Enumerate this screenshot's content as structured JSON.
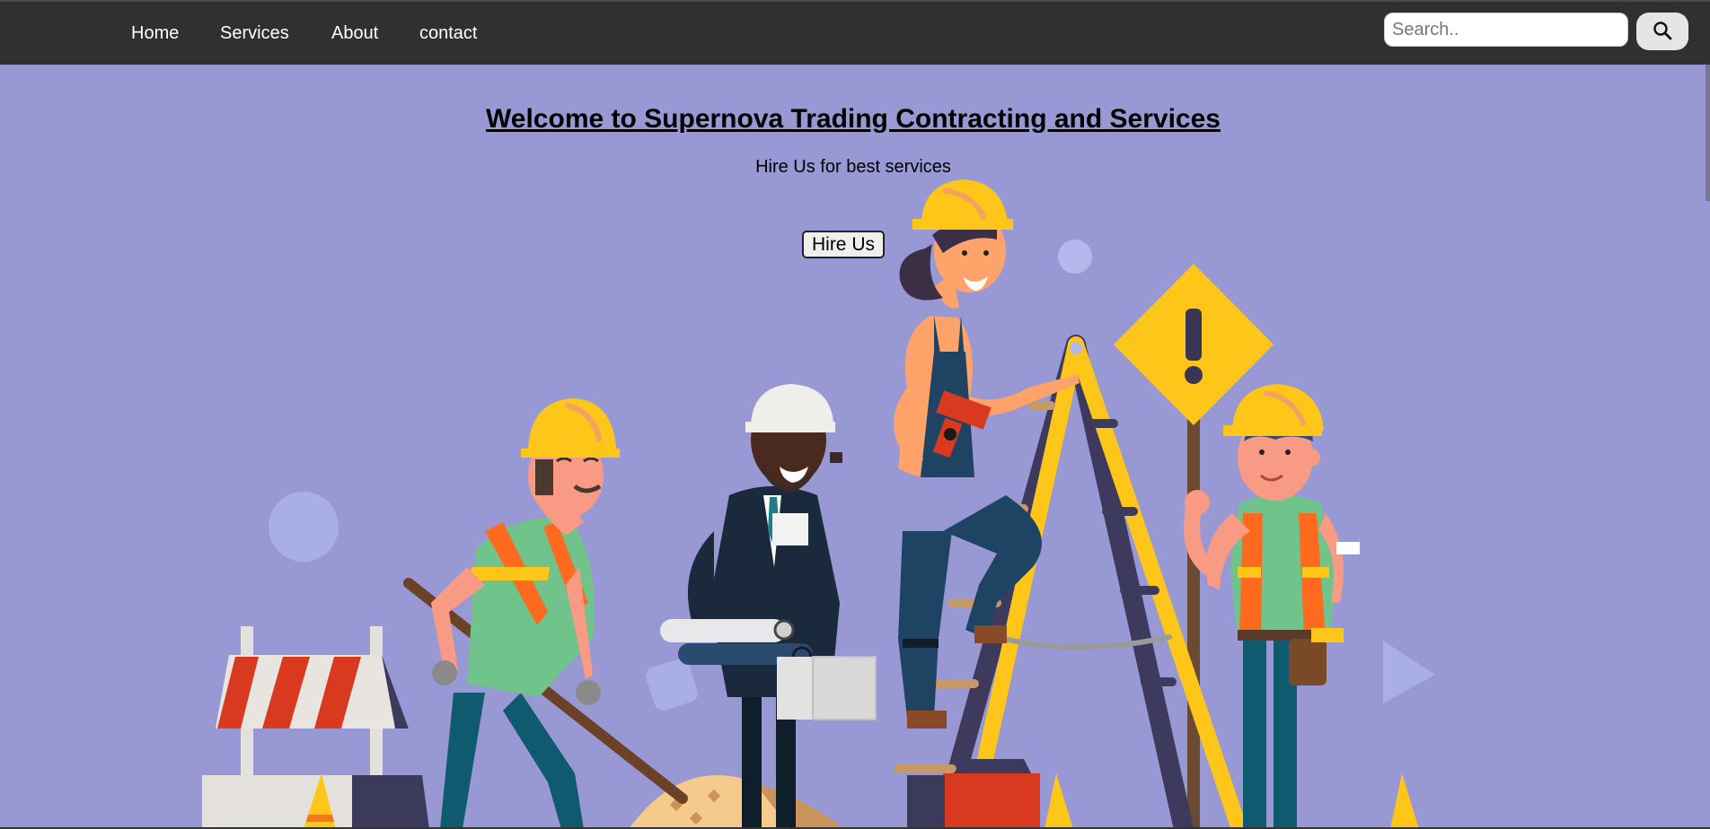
{
  "nav": {
    "items": [
      {
        "label": "Home"
      },
      {
        "label": "Services"
      },
      {
        "label": "About"
      },
      {
        "label": "contact"
      }
    ]
  },
  "search": {
    "placeholder": "Search..",
    "icon": "search-icon"
  },
  "hero": {
    "headline": "Welcome to Supernova Trading Contracting and Services",
    "subtitle": "Hire Us for best services",
    "button_label": "Hire Us",
    "illustration": "construction-workers-illustration"
  },
  "colors": {
    "navbar": "#303030",
    "hero_background": "#9899d4",
    "helmet_yellow": "#ffc61a",
    "vest_orange": "#ff6a1f",
    "ladder_dark": "#3e3a5e"
  }
}
